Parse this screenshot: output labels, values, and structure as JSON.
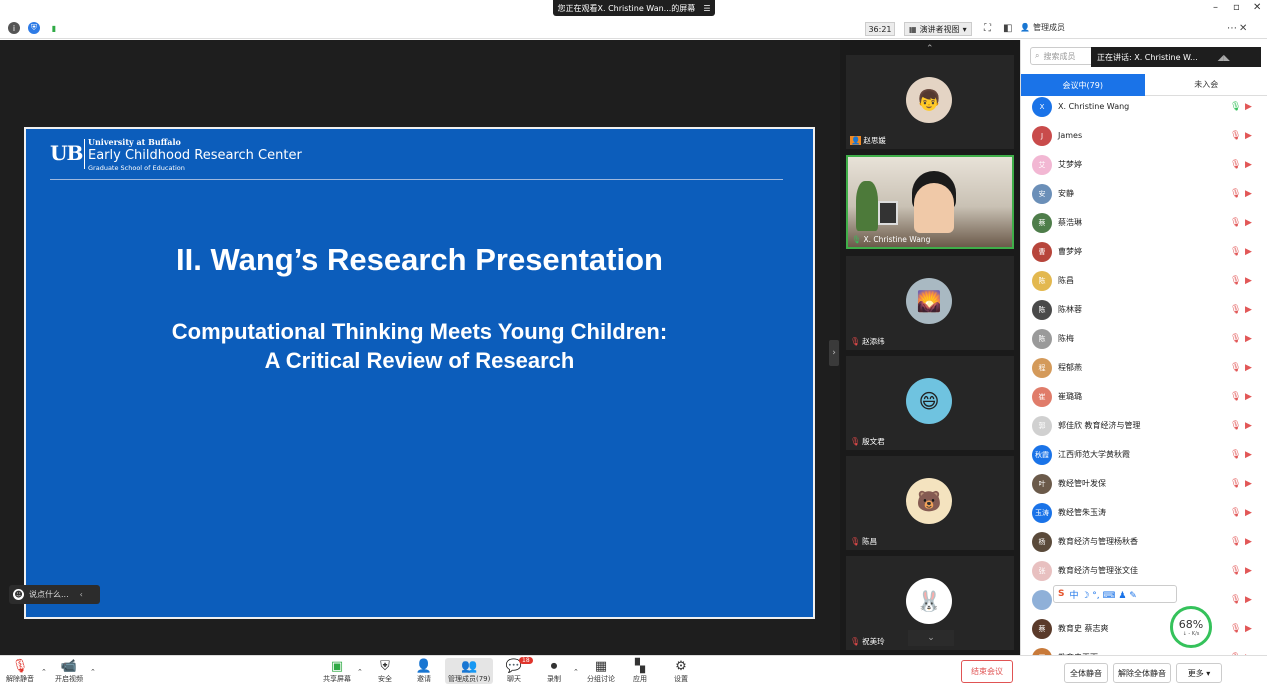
{
  "window": {
    "share_banner": "您正在观看X. Christine Wan...的屏幕",
    "banner_menu_icon": "menu-icon",
    "controls": [
      "–",
      "▫",
      "✕"
    ]
  },
  "topbar": {
    "timer": "36:21",
    "view_mode": "演讲者视图",
    "panel_title": "管理成员"
  },
  "slide": {
    "ub_mark": "UB",
    "ub_line1": "University at Buffalo",
    "ub_line2": "Early Childhood Research Center",
    "ub_line3": "Graduate School of Education",
    "title": "II. Wang’s Research Presentation",
    "subtitle_line1": "Computational Thinking Meets Young Children:",
    "subtitle_line2": "A Critical Review of Research"
  },
  "chat_box": {
    "placeholder": "说点什么..."
  },
  "thumbnails": [
    {
      "name": "赵思媛",
      "avatar": "👦"
    },
    {
      "name": "X. Christine Wang",
      "avatar": "video",
      "active": true
    },
    {
      "name": "赵添纬",
      "avatar": "🌄"
    },
    {
      "name": "殷文君",
      "avatar": "😄"
    },
    {
      "name": "陈昌",
      "avatar": "🐻"
    },
    {
      "name": "祝美玲",
      "avatar": "🐰"
    }
  ],
  "panel": {
    "search_placeholder": "搜索成员",
    "speaking": "正在讲话: X. Christine W...",
    "tab_in_meeting": "会议中(79)",
    "tab_not_joined": "未入会",
    "participants": [
      {
        "name": "X. Christine Wang",
        "avatar": "X",
        "color": "#1a73e8",
        "mic_on": true
      },
      {
        "name": "James",
        "avatar": "J",
        "color": "#c94b4b"
      },
      {
        "name": "艾梦婷",
        "avatar": "艾",
        "color": "#f2b7d3"
      },
      {
        "name": "安静",
        "avatar": "安",
        "color": "#6b8fb8"
      },
      {
        "name": "蔡浩琳",
        "avatar": "蔡",
        "color": "#4e7d4a"
      },
      {
        "name": "曹梦婷",
        "avatar": "曹",
        "color": "#b7453b"
      },
      {
        "name": "陈昌",
        "avatar": "陈",
        "color": "#e3b84f"
      },
      {
        "name": "陈林蓉",
        "avatar": "陈",
        "color": "#4a4a4a"
      },
      {
        "name": "陈梅",
        "avatar": "陈",
        "color": "#9a9a9a"
      },
      {
        "name": "程郁燕",
        "avatar": "程",
        "color": "#d49a5a"
      },
      {
        "name": "崔璐璐",
        "avatar": "崔",
        "color": "#e07c6a"
      },
      {
        "name": "郭佳欣 教育经济与管理",
        "avatar": "郭",
        "color": "#d0d0d0"
      },
      {
        "name": "江西师范大学黄秋霞",
        "avatar": "秋霞",
        "color": "#1a73e8"
      },
      {
        "name": "教经管叶发保",
        "avatar": "叶",
        "color": "#6b5a4a"
      },
      {
        "name": "教经管朱玉涛",
        "avatar": "玉涛",
        "color": "#1a73e8"
      },
      {
        "name": "教育经济与管理杨秋香",
        "avatar": "杨",
        "color": "#5a4a3a"
      },
      {
        "name": "教育经济与管理张文佳",
        "avatar": "张",
        "color": "#e8c0c0"
      },
      {
        "name": "",
        "avatar": "",
        "color": "#8fb0d8"
      },
      {
        "name": "教育史 蔡志爽",
        "avatar": "蔡",
        "color": "#5a3a2a"
      },
      {
        "name": "教育史王雨",
        "avatar": "王",
        "color": "#c87a3a"
      }
    ],
    "net_percent": "68%",
    "net_speed": "↓ - K/s",
    "ime_text": "中 ☽ °, ⌨ ♟ ✎"
  },
  "bottombar": {
    "unmute": "解除静音",
    "start_video": "开启视频",
    "share_screen": "共享屏幕",
    "security": "安全",
    "invite": "邀请",
    "manage_members": "管理成员(79)",
    "chat": "聊天",
    "chat_badge": "18",
    "record": "录制",
    "breakout": "分组讨论",
    "apps": "应用",
    "settings": "设置",
    "end_meeting": "结束会议",
    "mute_all": "全体静音",
    "unmute_all": "解除全体静音",
    "more": "更多 ▾"
  }
}
